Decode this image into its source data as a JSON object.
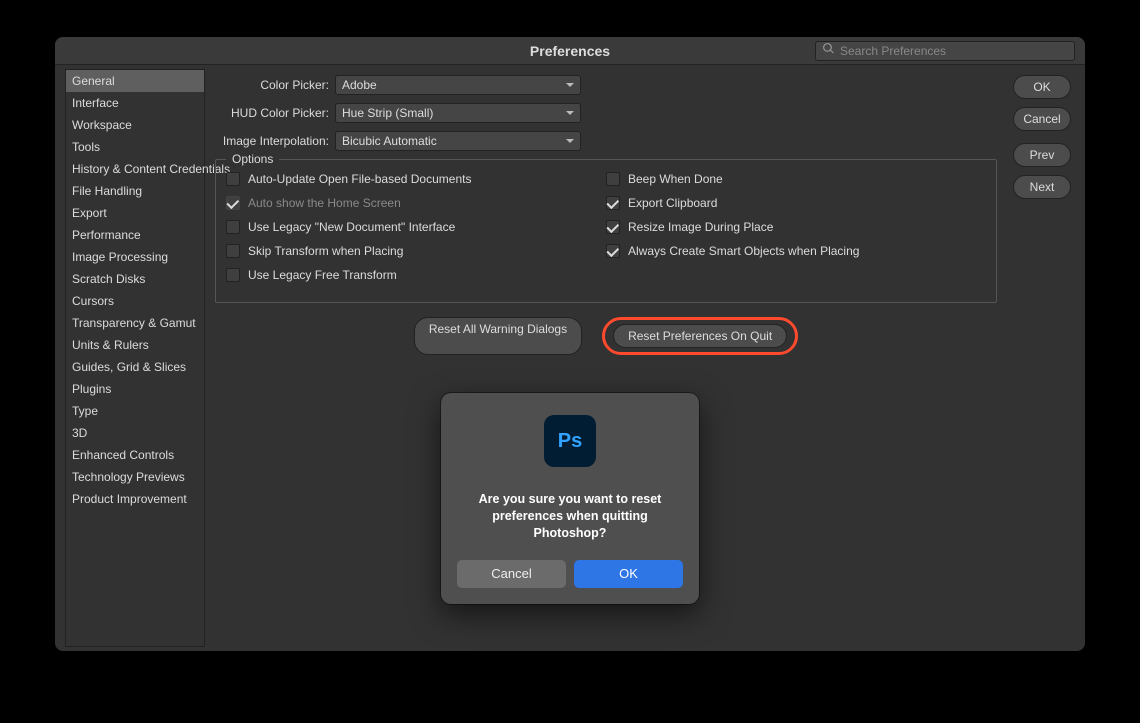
{
  "titlebar": {
    "title": "Preferences"
  },
  "search": {
    "placeholder": "Search Preferences"
  },
  "sidebar": {
    "selected_index": 0,
    "items": [
      "General",
      "Interface",
      "Workspace",
      "Tools",
      "History & Content Credentials",
      "File Handling",
      "Export",
      "Performance",
      "Image Processing",
      "Scratch Disks",
      "Cursors",
      "Transparency & Gamut",
      "Units & Rulers",
      "Guides, Grid & Slices",
      "Plugins",
      "Type",
      "3D",
      "Enhanced Controls",
      "Technology Previews",
      "Product Improvement"
    ]
  },
  "main": {
    "settings": [
      {
        "label": "Color Picker:",
        "value": "Adobe"
      },
      {
        "label": "HUD Color Picker:",
        "value": "Hue Strip (Small)"
      },
      {
        "label": "Image Interpolation:",
        "value": "Bicubic Automatic"
      }
    ],
    "options_legend": "Options",
    "options_left": [
      {
        "label": "Auto-Update Open File-based Documents",
        "checked": false,
        "disabled": false
      },
      {
        "label": "Auto show the Home Screen",
        "checked": true,
        "disabled": true
      },
      {
        "label": "Use Legacy \"New Document\" Interface",
        "checked": false,
        "disabled": false
      },
      {
        "label": "Skip Transform when Placing",
        "checked": false,
        "disabled": false
      },
      {
        "label": "Use Legacy Free Transform",
        "checked": false,
        "disabled": false
      }
    ],
    "options_right": [
      {
        "label": "Beep When Done",
        "checked": false,
        "disabled": false
      },
      {
        "label": "Export Clipboard",
        "checked": true,
        "disabled": false
      },
      {
        "label": "Resize Image During Place",
        "checked": true,
        "disabled": false
      },
      {
        "label": "Always Create Smart Objects when Placing",
        "checked": true,
        "disabled": false
      }
    ],
    "buttons": {
      "reset_warnings": "Reset All Warning Dialogs",
      "reset_on_quit": "Reset Preferences On Quit"
    },
    "side_buttons": {
      "ok": "OK",
      "cancel": "Cancel",
      "prev": "Prev",
      "next": "Next"
    }
  },
  "modal": {
    "icon_text": "Ps",
    "message": "Are you sure you want to reset preferences when quitting Photoshop?",
    "cancel": "Cancel",
    "ok": "OK"
  }
}
